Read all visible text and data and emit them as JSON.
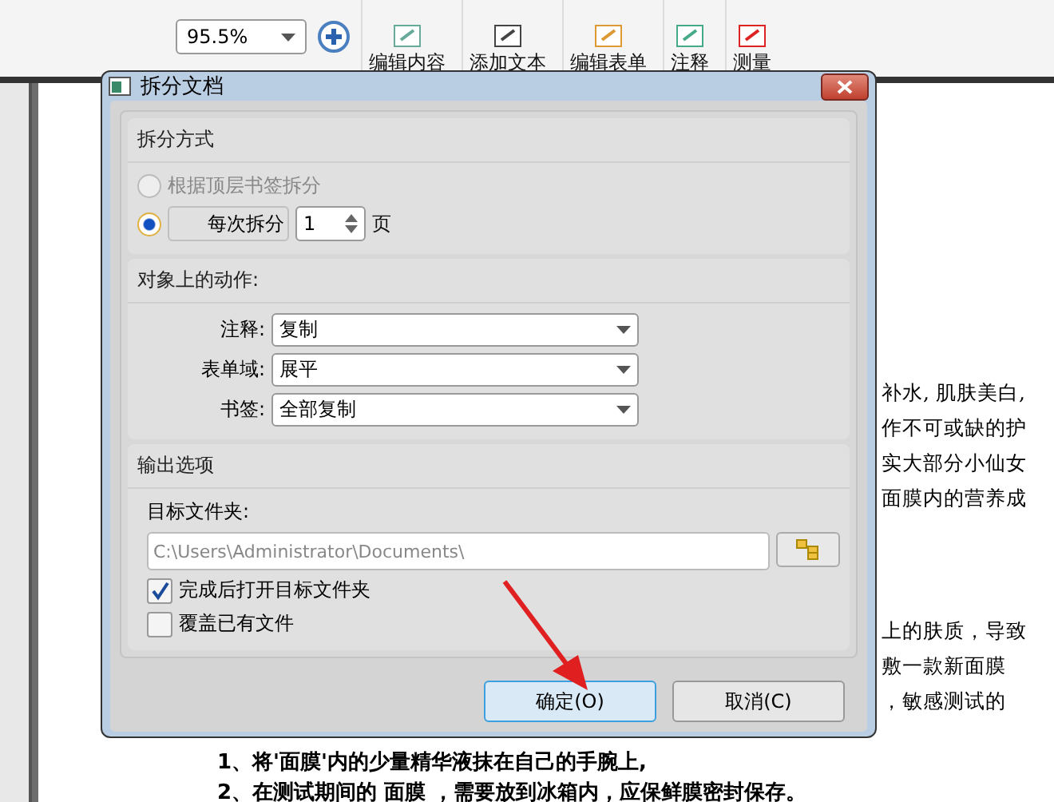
{
  "toolbar": {
    "zoom": "95.5%",
    "buttons": [
      {
        "label": "编辑内容",
        "kind": "edit"
      },
      {
        "label": "添加文本",
        "kind": "text"
      },
      {
        "label": "编辑表单",
        "kind": "form"
      },
      {
        "label": "注释",
        "kind": "comment"
      },
      {
        "label": "测量",
        "kind": "measure"
      }
    ]
  },
  "document": {
    "right_lines": [
      "补水, 肌肤美白,",
      "作不可或缺的护",
      "实大部分小仙女",
      "面膜内的营养成",
      "上的肤质，导致",
      "敷一款新面膜",
      "，敏感测试的"
    ],
    "bottom_lines": [
      "1、将'面膜'内的少量精华液抹在自己的手腕上,",
      "2、在测试期间的 面膜 ，需要放到冰箱内，应保鲜膜密封保存。"
    ]
  },
  "dialog": {
    "title": "拆分文档",
    "split_group": {
      "title": "拆分方式",
      "options": [
        {
          "label": "根据顶层书签拆分",
          "selected": false,
          "disabled": true
        },
        {
          "label": "每次拆分",
          "selected": true,
          "disabled": false
        }
      ],
      "pages": "1",
      "unit": "页"
    },
    "actions_group": {
      "title": "对象上的动作:",
      "fields": [
        {
          "label": "注释:",
          "value": "复制"
        },
        {
          "label": "表单域:",
          "value": "展平"
        },
        {
          "label": "书签:",
          "value": "全部复制"
        }
      ]
    },
    "output_group": {
      "title": "输出选项",
      "folder_label": "目标文件夹:",
      "folder": "C:\\Users\\Administrator\\Documents\\",
      "checks": [
        {
          "label": "完成后打开目标文件夹",
          "checked": true
        },
        {
          "label": "覆盖已有文件",
          "checked": false
        }
      ]
    },
    "buttons": [
      {
        "label": "确定(O)",
        "selected": true
      },
      {
        "label": "取消(C)",
        "selected": false
      }
    ]
  }
}
